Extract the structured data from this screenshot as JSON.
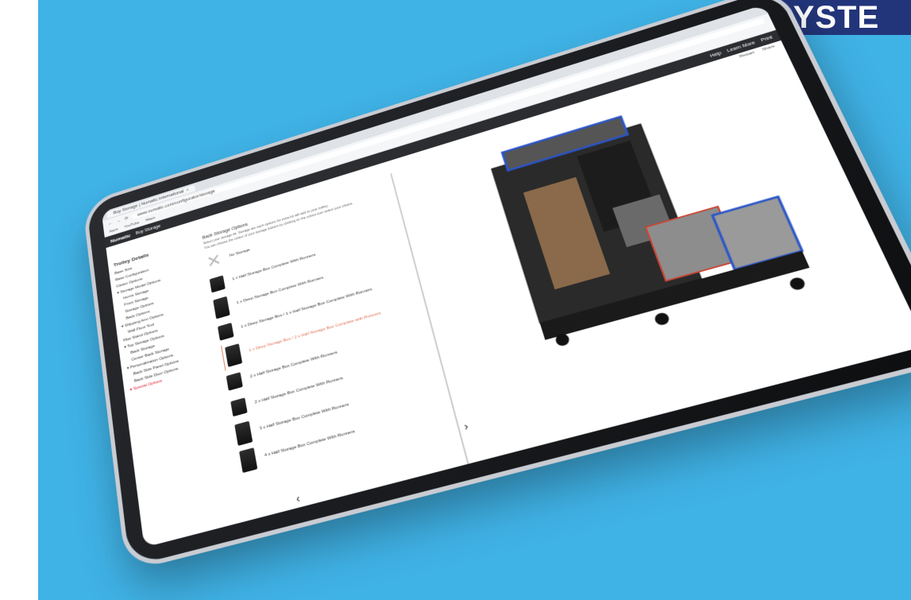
{
  "brand_badge": "SYSTE",
  "browser": {
    "tab_title": "Buy Storage | Numatic International",
    "tab_close": "×",
    "nav_back": "←",
    "nav_forward": "→",
    "nav_reload": "⟳",
    "url": "www.numatic.com/configurator/storage",
    "bookmarks": [
      "Apps",
      "YouTube",
      "Maps"
    ]
  },
  "app": {
    "logo": "Numatic",
    "section": "Buy Storage",
    "links": [
      "Help",
      "Learn More",
      "Print"
    ],
    "sub_links": [
      "Restart",
      "Share"
    ]
  },
  "left_nav": {
    "title": "Trolley Details",
    "items": [
      {
        "label": "Base Size",
        "indent": false,
        "red": false
      },
      {
        "label": "Base Configuration",
        "indent": false,
        "red": false
      },
      {
        "label": "Castor Options",
        "indent": false,
        "red": false
      },
      {
        "label": "▾ Storage Model Options",
        "indent": false,
        "red": false
      },
      {
        "label": "Home Storage",
        "indent": true,
        "red": false
      },
      {
        "label": "Front Storage",
        "indent": true,
        "red": false
      },
      {
        "label": "Storage Options",
        "indent": true,
        "red": false
      },
      {
        "label": "Back Options",
        "indent": true,
        "red": false
      },
      {
        "label": "▾ Shipping Arm Options",
        "indent": false,
        "red": false
      },
      {
        "label": "Wall Floor Tool",
        "indent": true,
        "red": false
      },
      {
        "label": "Mop Stand Options",
        "indent": false,
        "red": false
      },
      {
        "label": "▾ Top Storage Options",
        "indent": false,
        "red": false
      },
      {
        "label": "Back Storage",
        "indent": true,
        "red": false
      },
      {
        "label": "Center Back Storage",
        "indent": true,
        "red": false
      },
      {
        "label": "▾ Personalization Options",
        "indent": false,
        "red": false
      },
      {
        "label": "Back Side Panel Options",
        "indent": true,
        "red": false
      },
      {
        "label": "Back Side Door Options",
        "indent": true,
        "red": false
      },
      {
        "label": "● Special Options",
        "indent": false,
        "red": true
      }
    ]
  },
  "options_panel": {
    "heading": "Back Storage Options",
    "desc_1": "Select your storage kit. Storage are each options for extra kit will add to your trolley.",
    "desc_2": "You can choose the colour of your storage lockers by clicking on the colour icon select your choice.",
    "items": [
      {
        "label": "No Storage",
        "type": "none",
        "selected": false
      },
      {
        "label": "1 x Half Storage Box Complete With Runners",
        "type": "box",
        "selected": false
      },
      {
        "label": "1 x Deep Storage Box Complete With Runners",
        "type": "tall",
        "selected": false
      },
      {
        "label": "1 x Deep Storage Box / 1 x Half Storage Box Complete With Runners",
        "type": "box",
        "selected": false
      },
      {
        "label": "1 x Deep Storage Box / 2 x Half Storage Box Complete with Runners",
        "type": "tall",
        "selected": true
      },
      {
        "label": "2 x Half Storage Box Complete With Runners",
        "type": "box",
        "selected": false
      },
      {
        "label": "2 x Half Storage Box Complete With Runners",
        "type": "box",
        "selected": false
      },
      {
        "label": "3 x Half Storage Box Complete With Runners",
        "type": "tall",
        "selected": false
      },
      {
        "label": "4 x Half Storage Box Complete With Runners",
        "type": "tall",
        "selected": false
      }
    ],
    "arrow_left": "‹"
  },
  "viewer": {
    "arrow_right": "›"
  },
  "colors": {
    "background": "#3fb2e6",
    "badge": "#22357a",
    "selected": "#e07050"
  }
}
